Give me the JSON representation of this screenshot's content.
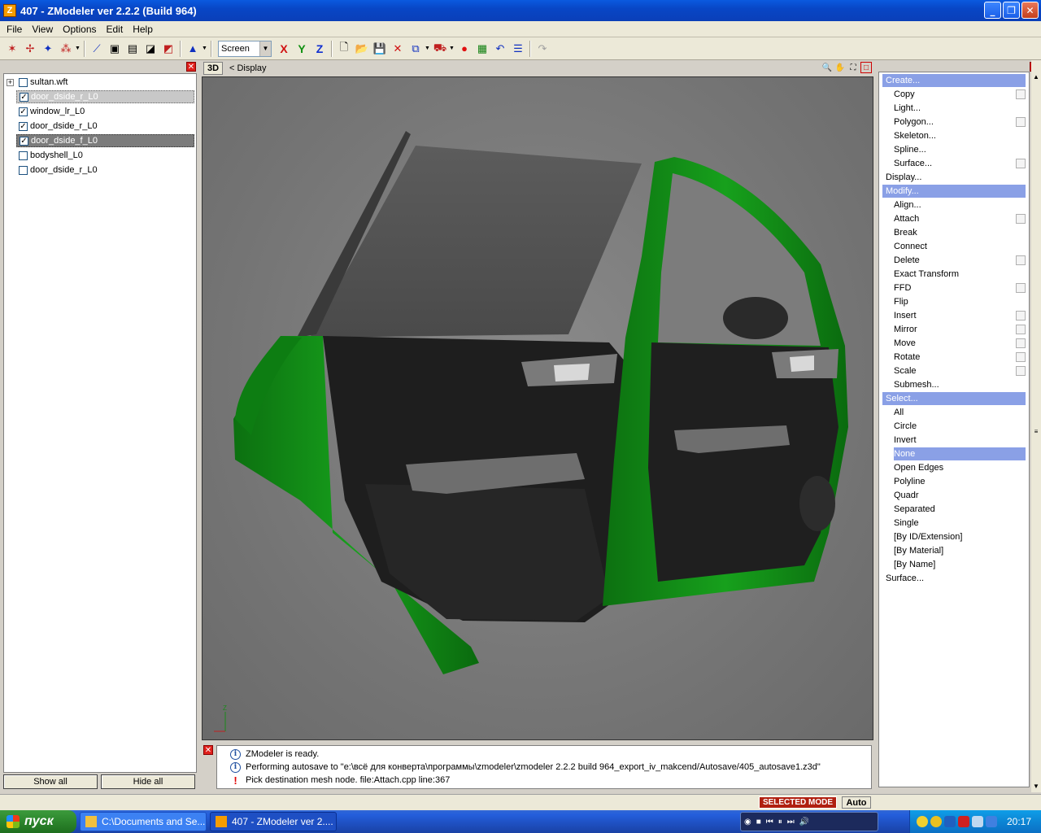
{
  "window": {
    "app_icon_letter": "Z",
    "title": "407 - ZModeler ver 2.2.2 (Build 964)",
    "min_label": "_",
    "max_label": "❐",
    "close_label": "✕"
  },
  "menu": [
    "File",
    "View",
    "Options",
    "Edit",
    "Help"
  ],
  "toolbar": {
    "coord_system": "Screen",
    "axis_x": "X",
    "axis_y": "Y",
    "axis_z": "Z"
  },
  "tree": {
    "items": [
      {
        "label": "sultan.wft",
        "checked": false,
        "expander": "+"
      },
      {
        "label": "door_dside_r_L0",
        "checked": true
      },
      {
        "label": "window_lr_L0",
        "checked": true
      },
      {
        "label": "door_dside_r_L0",
        "checked": true
      },
      {
        "label": "door_dside_f_L0",
        "checked": true
      },
      {
        "label": "bodyshell_L0",
        "checked": false
      },
      {
        "label": "door_dside_r_L0",
        "checked": false
      }
    ],
    "check_mark": "✓",
    "show_all": "Show all",
    "hide_all": "Hide all"
  },
  "viewport": {
    "tab": "3D",
    "title": "<  Display",
    "axis_z": "Z"
  },
  "log": {
    "info_glyph": "i",
    "error_glyph": "!",
    "lines": [
      "ZModeler is ready.",
      "Performing autosave to \"e:\\всё для конверта\\программы\\zmodeler\\zmodeler 2.2.2 build 964_export_iv_makcend/Autosave/405_autosave1.z3d\"",
      "Pick destination mesh node. file:Attach.cpp line:367"
    ]
  },
  "commands": {
    "create": "Create...",
    "create_items": [
      "Copy",
      "Light...",
      "Polygon...",
      "Skeleton...",
      "Spline...",
      "Surface..."
    ],
    "display": "Display...",
    "modify": "Modify...",
    "modify_items": [
      "Align...",
      "Attach",
      "Break",
      "Connect",
      "Delete",
      "Exact Transform",
      "FFD",
      "Flip",
      "Insert",
      "Mirror",
      "Move",
      "Rotate",
      "Scale",
      "Submesh..."
    ],
    "select": "Select...",
    "select_items": [
      "All",
      "Circle",
      "Invert",
      "None",
      "Open Edges",
      "Polyline",
      "Quadr",
      "Separated",
      "Single",
      "[By ID/Extension]",
      "[By Material]",
      "[By Name]"
    ],
    "surface": "Surface..."
  },
  "status": {
    "mode": "SELECTED MODE",
    "auto": "Auto"
  },
  "taskbar": {
    "start": "пуск",
    "task1": "C:\\Documents and Se...",
    "task2": "407 - ZModeler ver 2....",
    "clock": "20:17"
  },
  "colors": {
    "door_green": "#0f8a14",
    "panel_dark": "#242424",
    "selection_blue": "#8aa0e6"
  }
}
